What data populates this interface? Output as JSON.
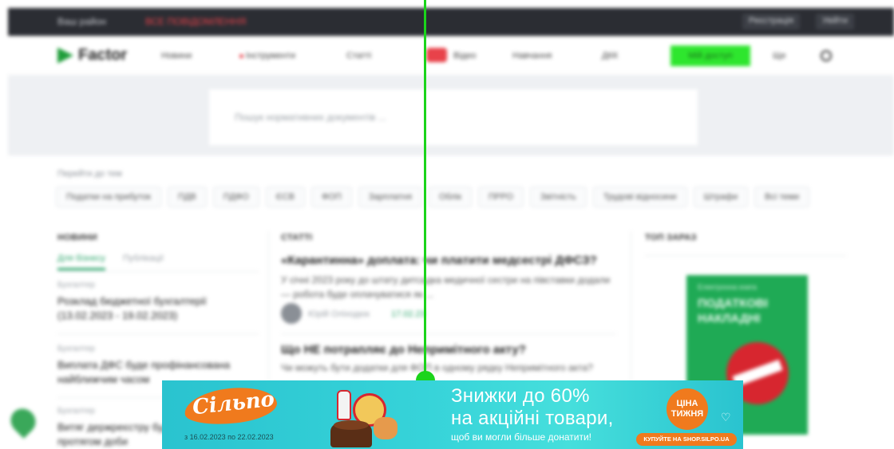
{
  "topbar": {
    "region_label": "Ваш район",
    "alert_text": "ВСЕ ПОВІДОМЛЕННЯ",
    "register_label": "Реєстрація",
    "login_label": "Увійти"
  },
  "nav": {
    "logo_text": "Factor",
    "items": [
      "Новини",
      "Інструменти",
      "Статті",
      "Відео",
      "Навчання",
      "ДКК"
    ],
    "cta_label": "Мій доступ",
    "extra_label": "Ще"
  },
  "search": {
    "placeholder": "Пошук нормативних документів ..."
  },
  "tags": {
    "hint": "Перейти до тем",
    "items": [
      "Податки на прибуток",
      "ПДВ",
      "ПДФО",
      "ЄСВ",
      "ФОП",
      "Зарплатня",
      "Облік",
      "ПРРО",
      "Звітність",
      "Трудові відносини",
      "Штрафи",
      "Всі теми"
    ]
  },
  "columns": {
    "news_title": "НОВИНИ",
    "articles_title": "СТАТТІ",
    "top_title": "ТОП ЗАРАЗ"
  },
  "news_tabs": [
    "Для бізнесу",
    "Публікації"
  ],
  "news": [
    {
      "category": "Бухгалтер",
      "title": "Розклад бюджетної бухгалтерії (13.02.2023 - 19.02.2023)"
    },
    {
      "category": "Бухгалтер",
      "title": "Виплата ДФС буде профінансована найближчим часом"
    },
    {
      "category": "Бухгалтер",
      "title": "Витяг держреєстру будуть видавати протягом доби"
    }
  ],
  "articles": [
    {
      "title": "«Карантинна» доплата: чи платити медсестрі ДФСЗ?",
      "excerpt": "У січні 2023 року до штату дитсадка медичної сестри на півставки додали — робота буде оплачуватися як ..."
    },
    {
      "title": "Що НЕ потрапляє до Непримітного акту?",
      "excerpt": "Чи можуть бути додатки для ФОП в одному рядку Непримітного акта?"
    }
  ],
  "article_author": {
    "name": "Юрій Оліходюк",
    "date": "17.02.23"
  },
  "sidebar_book": {
    "small": "Електронна книга",
    "title": "ПОДАТКОВІ НАКЛАДНІ"
  },
  "ad": {
    "brand": "Сільпо",
    "dates": "з 16.02.2023 по 22.02.2023",
    "headline_line1": "Знижки до 60%",
    "headline_line2": "на акційні товари,",
    "subline": "щоб ви могли більше донатити!",
    "badge_line1": "ЦІНА",
    "badge_line2": "ТИЖНЯ",
    "cta": "КУПУЙТЕ НА SHOP.SILPO.UA",
    "colors": {
      "bg": "#36d3d9",
      "brand_orange": "#f07a1d",
      "text": "#ffffff"
    }
  },
  "overlay": {
    "cursor_color": "#1bd41b"
  }
}
